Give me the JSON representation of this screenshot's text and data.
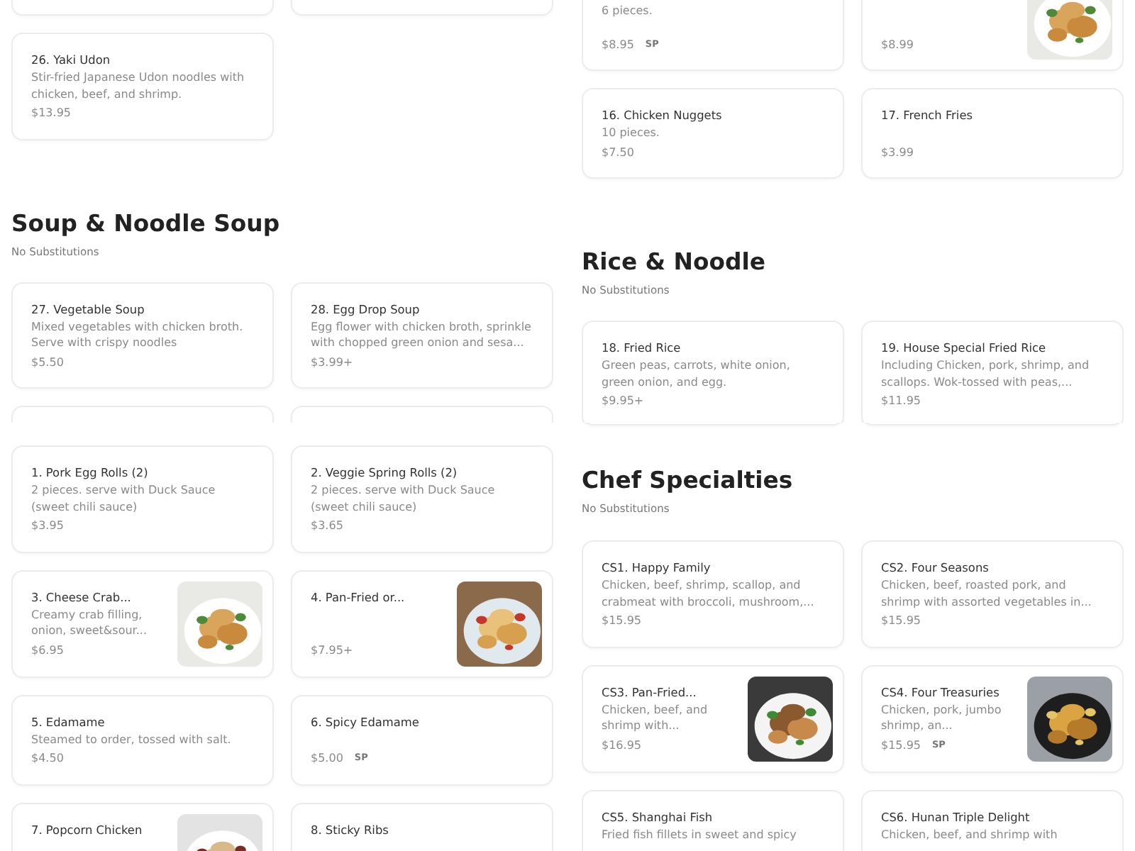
{
  "columns": [
    {
      "panes": [
        {
          "blocks": [
            {
              "kind": "card_edges"
            },
            {
              "kind": "cards",
              "items": [
                {
                  "title": "26. Yaki Udon",
                  "description": "Stir-fried Japanese Udon noodles with chicken, beef, and shrimp.",
                  "price": "$13.95"
                }
              ]
            },
            {
              "kind": "section",
              "title": "Soup & Noodle Soup",
              "note": "No Substitutions"
            },
            {
              "kind": "cards",
              "items": [
                {
                  "title": "27. Vegetable Soup",
                  "description": "Mixed vegetables with chicken broth. Serve with crispy noodles",
                  "price": "$5.50"
                },
                {
                  "title": "28. Egg Drop Soup",
                  "description": "Egg flower with chicken broth, sprinkle with chopped green onion and sesa...",
                  "price": "$3.99+"
                }
              ]
            },
            {
              "kind": "card_edges"
            }
          ]
        },
        {
          "blocks": [
            {
              "kind": "cards",
              "items": [
                {
                  "title": "1. Pork Egg Rolls (2)",
                  "description": "2 pieces. serve with Duck Sauce (sweet chili sauce)",
                  "price": "$3.95"
                },
                {
                  "title": "2. Veggie Spring Rolls (2)",
                  "description": "2 pieces. serve with Duck Sauce (sweet chili sauce)",
                  "price": "$3.65"
                }
              ]
            },
            {
              "kind": "cards",
              "items": [
                {
                  "title": "3. Cheese Crab...",
                  "description": "Creamy crab filling, onion, sweet&sour...",
                  "price": "$6.95"
                },
                {
                  "title": "4. Pan-Fried or...",
                  "price": "$7.95+"
                }
              ]
            },
            {
              "kind": "cards",
              "items": [
                {
                  "title": "5. Edamame",
                  "description": "Steamed to order, tossed with salt.",
                  "price": "$4.50"
                },
                {
                  "title": "6. Spicy Edamame",
                  "price": "$5.00",
                  "badge": "SP"
                }
              ]
            },
            {
              "kind": "cards",
              "items": [
                {
                  "title": "7. Popcorn Chicken"
                },
                {
                  "title": "8. Sticky Ribs"
                }
              ]
            }
          ]
        }
      ]
    },
    {
      "panes": [
        {
          "blocks": [
            {
              "kind": "cards",
              "items": [
                {
                  "description": "6 pieces.",
                  "price": "$8.95",
                  "badge": "SP"
                },
                {
                  "price": "$8.99"
                }
              ]
            },
            {
              "kind": "cards",
              "items": [
                {
                  "title": "16. Chicken Nuggets",
                  "description": "10 pieces.",
                  "price": "$7.50"
                },
                {
                  "title": "17. French Fries",
                  "price": "$3.99"
                }
              ]
            },
            {
              "kind": "section",
              "title": "Rice & Noodle",
              "note": "No Substitutions"
            },
            {
              "kind": "cards",
              "items": [
                {
                  "title": "18. Fried Rice",
                  "description": "Green peas, carrots, white onion, green onion, and egg.",
                  "price": "$9.95+"
                },
                {
                  "title": "19. House Special Fried Rice",
                  "description": "Including Chicken, pork, shrimp, and scallops. Wok-tossed with peas,...",
                  "price": "$11.95"
                }
              ]
            }
          ]
        },
        {
          "blocks": [
            {
              "kind": "card_edges"
            },
            {
              "kind": "section",
              "title": "Chef Specialties",
              "note": "No Substitutions"
            },
            {
              "kind": "cards",
              "items": [
                {
                  "title": "CS1. Happy Family",
                  "description": "Chicken, beef, shrimp, scallop, and crabmeat with broccoli, mushroom,...",
                  "price": "$15.95"
                },
                {
                  "title": "CS2. Four Seasons",
                  "description": "Chicken, beef, roasted pork, and shrimp with assorted vegetables in...",
                  "price": "$15.95"
                }
              ]
            },
            {
              "kind": "cards",
              "items": [
                {
                  "title": "CS3. Pan-Fried...",
                  "description": "Chicken, beef, and shrimp with...",
                  "price": "$16.95"
                },
                {
                  "title": "CS4. Four Treasuries",
                  "description": "Chicken, pork, jumbo shrimp, an...",
                  "price": "$15.95",
                  "badge": "SP"
                }
              ]
            },
            {
              "kind": "cards",
              "items": [
                {
                  "title": "CS5. Shanghai Fish",
                  "description": "Fried fish fillets in sweet and spicy"
                },
                {
                  "title": "CS6. Hunan Triple Delight",
                  "description": "Chicken, beef, and shrimp with"
                }
              ]
            }
          ]
        }
      ]
    }
  ]
}
